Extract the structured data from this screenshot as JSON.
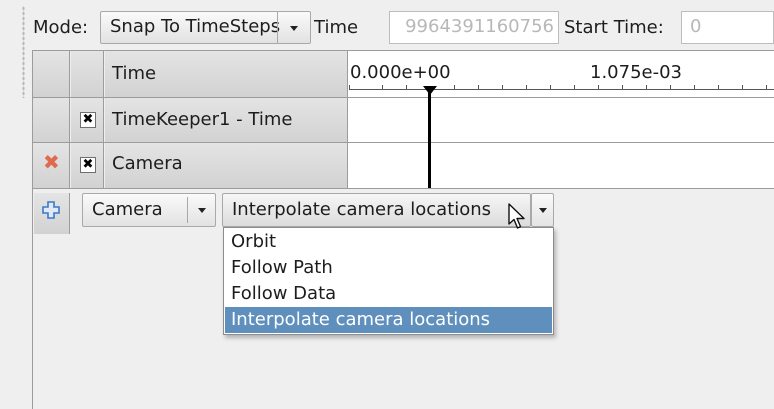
{
  "toolbar": {
    "mode_label": "Mode:",
    "mode_value": "Snap To TimeSteps",
    "time_label": "Time",
    "time_value": "9964391160756",
    "start_label": "Start Time:",
    "start_value": "0"
  },
  "timeline": {
    "header_label": "Time",
    "ticks": [
      "0.000e+00",
      "1.075e-03"
    ]
  },
  "tracks": [
    {
      "label": "TimeKeeper1 - Time",
      "checked": true
    },
    {
      "label": "Camera",
      "checked": true,
      "removable": true
    }
  ],
  "add_row": {
    "source_value": "Camera",
    "mode_value": "Interpolate camera locations"
  },
  "dropdown": {
    "options": [
      "Orbit",
      "Follow Path",
      "Follow Data",
      "Interpolate camera locations"
    ],
    "selected_index": 3
  },
  "colors": {
    "selection": "#5f8fbd",
    "remove_icon": "#e06a4f",
    "add_icon": "#3c78c8"
  }
}
